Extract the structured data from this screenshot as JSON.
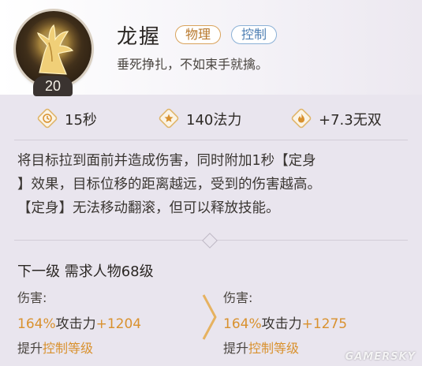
{
  "skill": {
    "name": "龙握",
    "level": "20",
    "tags": [
      "物理",
      "控制"
    ],
    "subtitle": "垂死挣扎，不如束手就擒。",
    "icon": "golden-dragon-claw"
  },
  "stats": [
    {
      "icon": "clock-icon",
      "value": "15秒"
    },
    {
      "icon": "star-icon",
      "value": "140法力"
    },
    {
      "icon": "flame-icon",
      "value": "+7.3无双"
    }
  ],
  "description": {
    "line1": "将目标拉到面前并造成伤害，同时附加1秒【定身",
    "line2": "】效果，目标位移的距离越远，受到的伤害越高。",
    "line3": "【定身】无法移动翻滚，但可以释放技能。"
  },
  "next_level": {
    "title": "下一级 需求人物68级",
    "current": {
      "label": "伤害:",
      "pct": "164%",
      "mid": "攻击力",
      "plus": "+1204",
      "up_prefix": "提升",
      "up_hl": "控制等级"
    },
    "next": {
      "label": "伤害:",
      "pct": "164%",
      "mid": "攻击力",
      "plus": "+1275",
      "up_prefix": "提升",
      "up_hl": "控制等级"
    }
  },
  "watermark": "GAMERSKY",
  "colors": {
    "accent_orange": "#d9912e",
    "physical_tag": "#b8782c",
    "control_tag": "#4e7fb3"
  }
}
